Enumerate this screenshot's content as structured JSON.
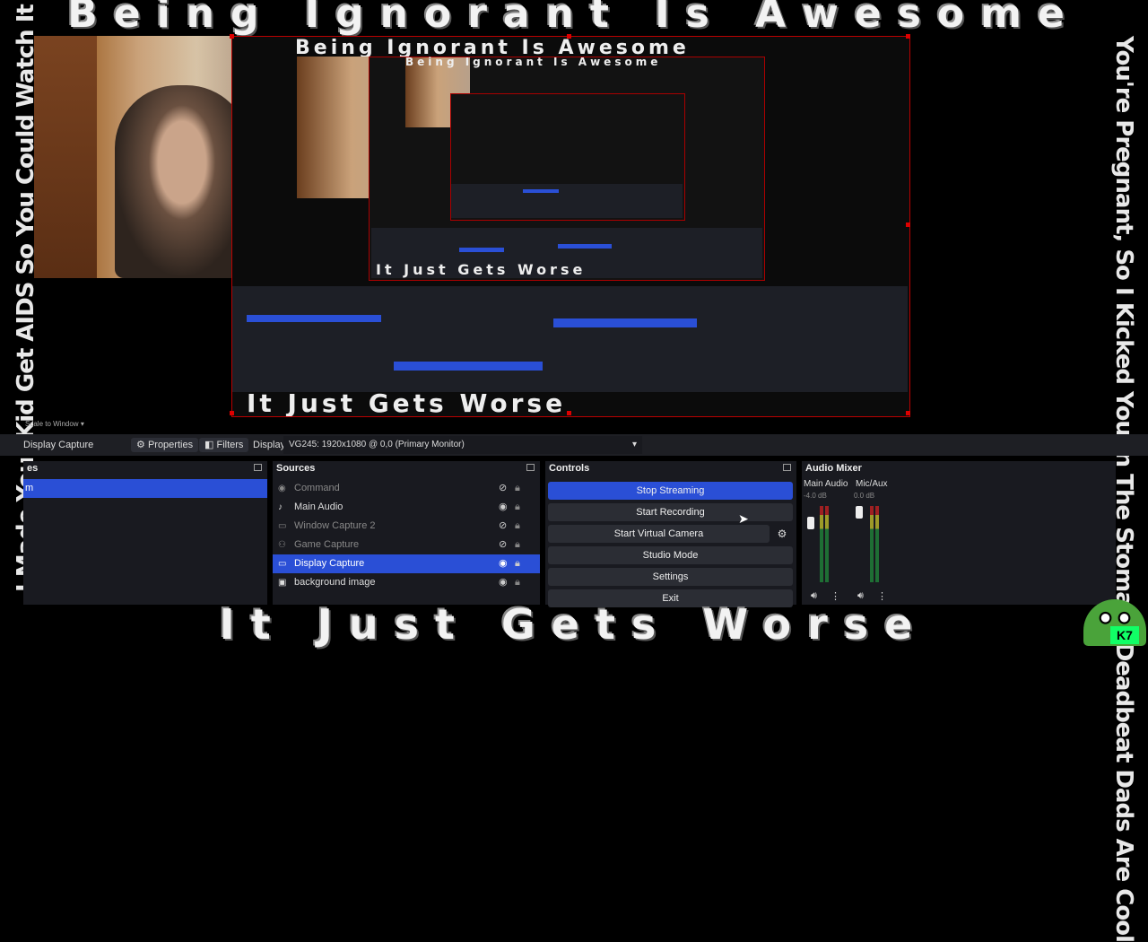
{
  "overlay": {
    "top_banner": "Being Ignorant Is Awesome",
    "bottom_banner": "It Just Gets Worse",
    "left_side_text": "I Made Your Kid Get AIDS So You Could Watch It Die   Tim Is Gay",
    "right_side_text": "You're Pregnant, So I Kicked You In The Stomach   Deadbeat Dads Are Cool",
    "badge": "K7"
  },
  "preview": {
    "banner_top": "Being Ignorant Is Awesome",
    "banner_bottom": "It Just Gets Worse",
    "side_text": "I Made Your Kid Get AIDS",
    "scale_label": "Scale to Window"
  },
  "toolbar": {
    "source_name": "Display Capture",
    "properties_label": "Properties",
    "filters_label": "Filters",
    "display_label": "Display",
    "display_value": "VG245: 1920x1080 @ 0,0 (Primary Monitor)"
  },
  "scenes": {
    "title": "es",
    "selected_label": "m"
  },
  "sources": {
    "title": "Sources",
    "items": [
      {
        "label": "Command",
        "icon": "terminal-icon",
        "visible": "hidden"
      },
      {
        "label": "Main Audio",
        "icon": "speaker-icon",
        "visible": "shown"
      },
      {
        "label": "Window Capture 2",
        "icon": "window-icon",
        "visible": "hidden"
      },
      {
        "label": "Game Capture",
        "icon": "gamepad-icon",
        "visible": "hidden"
      },
      {
        "label": "Display Capture",
        "icon": "monitor-icon",
        "visible": "shown"
      },
      {
        "label": "background image",
        "icon": "image-icon",
        "visible": "shown"
      }
    ]
  },
  "controls": {
    "title": "Controls",
    "stop_streaming": "Stop Streaming",
    "start_recording": "Start Recording",
    "start_virtual_camera": "Start Virtual Camera",
    "studio_mode": "Studio Mode",
    "settings": "Settings",
    "exit": "Exit"
  },
  "audio_mixer": {
    "title": "Audio Mixer",
    "channels": [
      {
        "name": "Main Audio",
        "level": "-4.0 dB"
      },
      {
        "name": "Mic/Aux",
        "level": "0.0 dB"
      }
    ]
  },
  "colors": {
    "accent": "#2a4fd6",
    "panel": "#191a20",
    "frame": "#b00000"
  }
}
